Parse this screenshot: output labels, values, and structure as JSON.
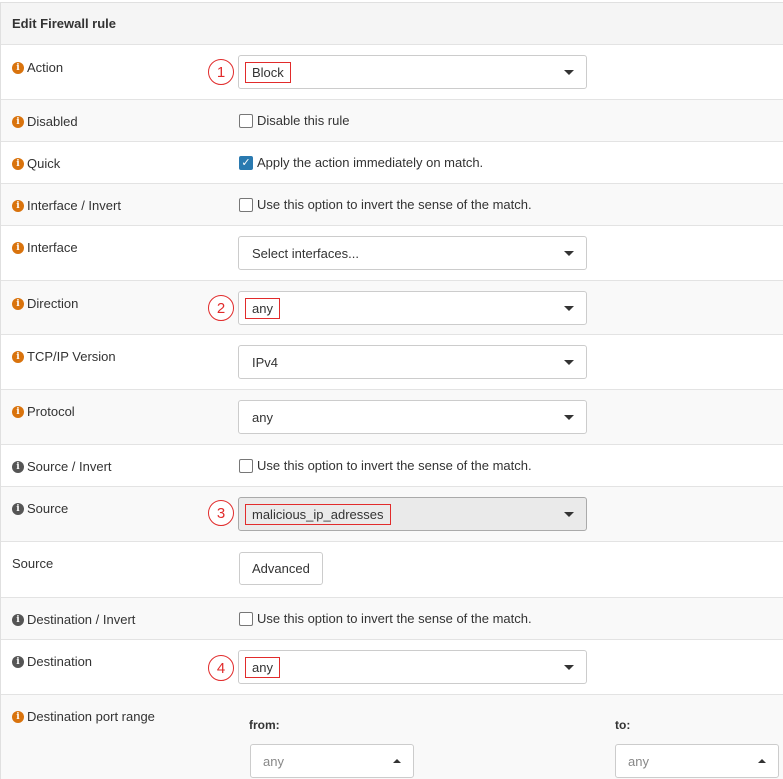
{
  "panel": {
    "title": "Edit Firewall rule"
  },
  "rows": {
    "action": {
      "label": "Action",
      "value": "Block",
      "marker": "1"
    },
    "disabled": {
      "label": "Disabled",
      "checkbox_label": "Disable this rule",
      "checked": false
    },
    "quick": {
      "label": "Quick",
      "checkbox_label": "Apply the action immediately on match.",
      "checked": true
    },
    "interface_invert": {
      "label": "Interface / Invert",
      "checkbox_label": "Use this option to invert the sense of the match.",
      "checked": false
    },
    "interface": {
      "label": "Interface",
      "value": "Select interfaces..."
    },
    "direction": {
      "label": "Direction",
      "value": "any",
      "marker": "2"
    },
    "tcpip_version": {
      "label": "TCP/IP Version",
      "value": "IPv4"
    },
    "protocol": {
      "label": "Protocol",
      "value": "any"
    },
    "source_invert": {
      "label": "Source / Invert",
      "checkbox_label": "Use this option to invert the sense of the match.",
      "checked": false
    },
    "source": {
      "label": "Source",
      "value": "malicious_ip_adresses",
      "marker": "3"
    },
    "source_advanced": {
      "label": "Source",
      "button_label": "Advanced"
    },
    "destination_invert": {
      "label": "Destination / Invert",
      "checkbox_label": "Use this option to invert the sense of the match.",
      "checked": false
    },
    "destination": {
      "label": "Destination",
      "value": "any",
      "marker": "4"
    },
    "destination_port_range": {
      "label": "Destination port range",
      "from_label": "from:",
      "to_label": "to:",
      "from_value": "any",
      "to_value": "any"
    }
  },
  "colors": {
    "info_icon": "#d9730d",
    "info_icon_gray": "#555555",
    "annotation": "#e12b2b",
    "checkbox_checked": "#2a7ab0"
  },
  "icons": {
    "info": "info-circle-icon",
    "dropdown": "caret-down-icon",
    "check": "checkmark-icon"
  }
}
